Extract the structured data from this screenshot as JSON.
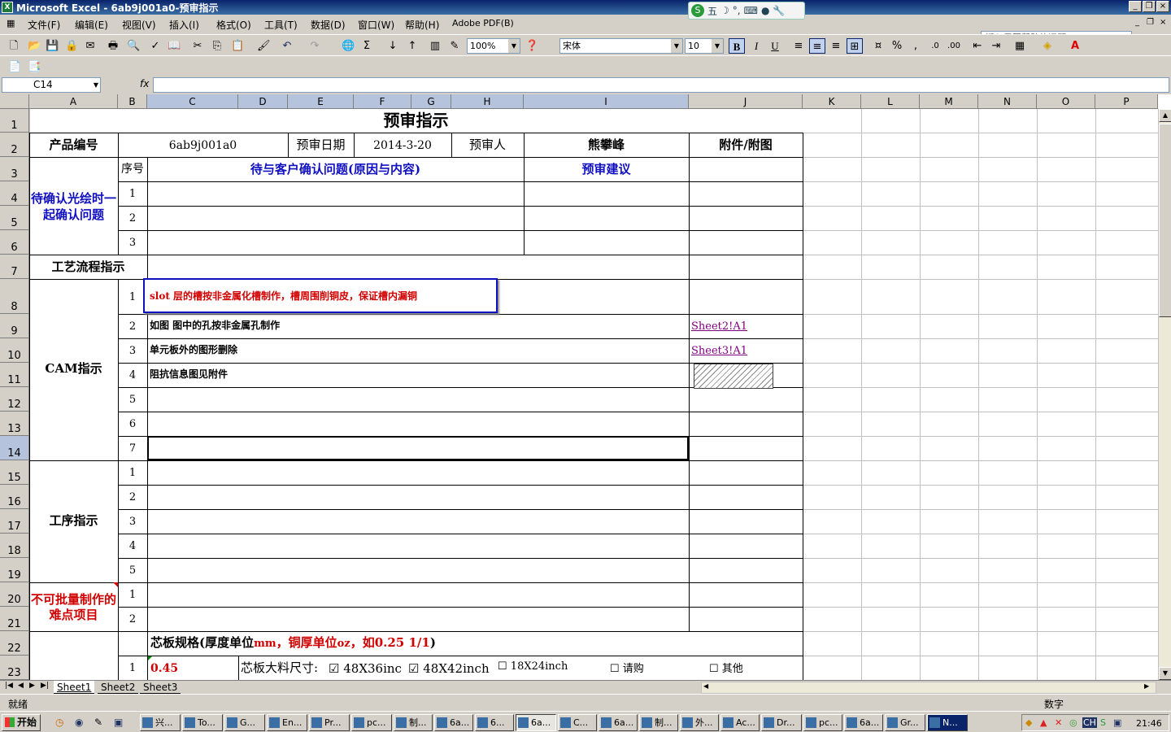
{
  "window": {
    "title": "Microsoft Excel - 6ab9j001a0-预审指示",
    "min": "_",
    "restore": "❐",
    "close": "×"
  },
  "ime": {
    "label": "五",
    "items": [
      "☽",
      "°,",
      "⌨",
      "●",
      "🔧"
    ]
  },
  "menu": {
    "items": [
      "文件(F)",
      "编辑(E)",
      "视图(V)",
      "插入(I)",
      "格式(O)",
      "工具(T)",
      "数据(D)",
      "窗口(W)",
      "帮助(H)",
      "Adobe PDF(B)"
    ],
    "ask": "键入需要帮助的问题"
  },
  "toolbar": {
    "zoom": "100%",
    "font": "宋体",
    "size": "10",
    "bold": "B",
    "italic": "I",
    "underline": "U",
    "percent": "%",
    "comma": ",",
    "sigma": "Σ"
  },
  "formula": {
    "cell_ref": "C14",
    "fx": "fx",
    "value": ""
  },
  "columns": [
    "A",
    "B",
    "C",
    "D",
    "E",
    "F",
    "G",
    "H",
    "I",
    "J",
    "K",
    "L",
    "M",
    "N",
    "O",
    "P"
  ],
  "rows": [
    "1",
    "2",
    "3",
    "4",
    "5",
    "6",
    "7",
    "8",
    "9",
    "10",
    "11",
    "12",
    "13",
    "14",
    "15",
    "16",
    "17",
    "18",
    "19",
    "20",
    "21",
    "22",
    "23"
  ],
  "sheet": {
    "title": "预审指示",
    "product_label": "产品编号",
    "product_value": "6ab9j001a0",
    "date_label": "预审日期",
    "date_value": "2014-3-20",
    "person_label": "预审人",
    "person_value": "熊攀峰",
    "attach_label": "附件/附图",
    "seq_label": "序号",
    "confirm_header": "待与客户确认问题(原因与内容)",
    "advice_header": "预审建议",
    "confirm_section": "待确认光绘时一起确认问题",
    "confirm_seq": [
      "1",
      "2",
      "3"
    ],
    "process_label": "工艺流程指示",
    "cam_label": "CAM指示",
    "cam_seq": [
      "1",
      "2",
      "3",
      "4",
      "5",
      "6",
      "7"
    ],
    "cam_items": [
      "slot 层的槽按非金属化槽制作，槽周围削铜皮，保证槽内漏铜",
      "如图 图中的孔按非金属孔制作",
      "单元板外的图形删除",
      "阻抗信息图见附件",
      "",
      "",
      ""
    ],
    "cam_links": [
      "",
      "Sheet2!A1",
      "Sheet3!A1",
      "",
      "",
      "",
      ""
    ],
    "step_label": "工序指示",
    "step_seq": [
      "1",
      "2",
      "3",
      "4",
      "5"
    ],
    "hard_label": "不可批量制作的难点项目",
    "hard_seq": [
      "1",
      "2"
    ],
    "core_spec": {
      "p1": "芯板规格(厚度单位",
      "u1": "mm",
      "p2": "，铜厚单位",
      "u2": "oz",
      "p3": "，如0.25 1/1",
      ")": ")"
    },
    "r23_seq": "1",
    "r23_value": "0.45",
    "core_size_label": "芯板大料尺寸:",
    "core_options": [
      {
        "mark": "☑",
        "label": "48X36inc"
      },
      {
        "mark": "☑",
        "label": "48X42inch"
      },
      {
        "mark": "☐",
        "label": "18X24inch"
      },
      {
        "mark": "☐",
        "label": "请购"
      },
      {
        "mark": "☐",
        "label": "其他"
      }
    ]
  },
  "tabs": [
    "Sheet1",
    "Sheet2",
    "Sheet3"
  ],
  "status": {
    "left": "就绪",
    "right": "数字"
  },
  "taskbar": {
    "start": "开始",
    "tasks": [
      "兴...",
      "To...",
      "G...",
      "En...",
      "Pr...",
      "pc...",
      "制...",
      "6a...",
      "6...",
      "6a...",
      "C...",
      "6a...",
      "制...",
      "外...",
      "Ac...",
      "Dr...",
      "pc...",
      "6a...",
      "Gr...",
      "N..."
    ],
    "clock": "21:46",
    "lang": "CH"
  }
}
